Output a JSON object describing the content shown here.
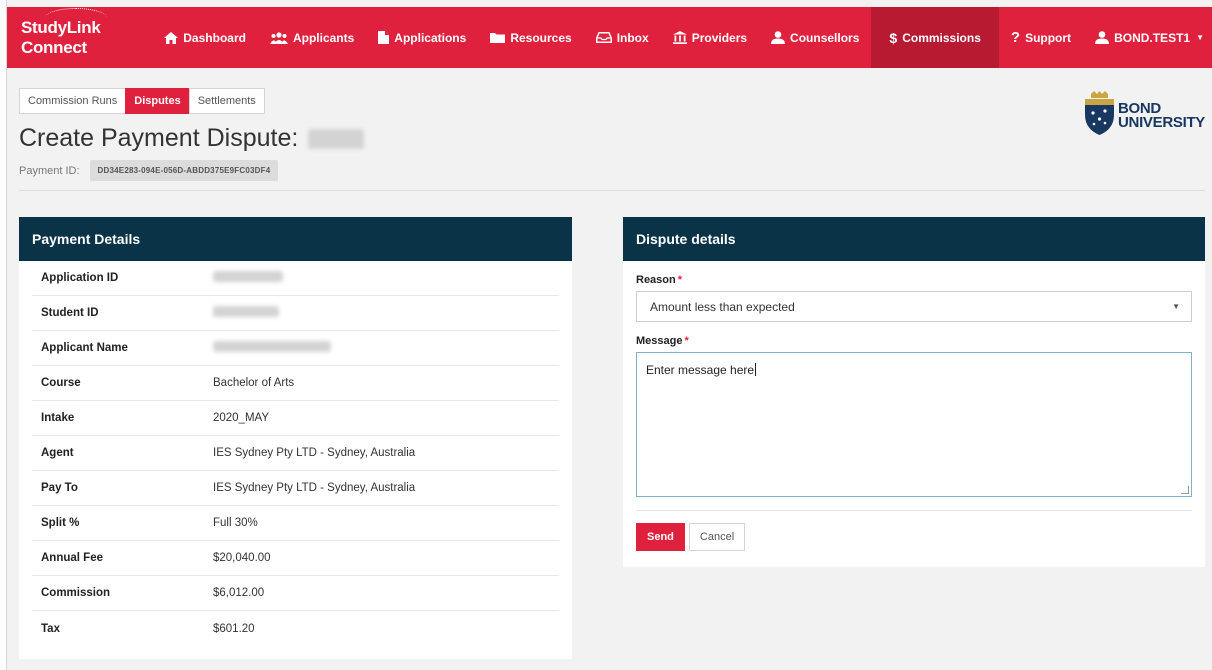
{
  "brand": {
    "name": "StudyLink Connect"
  },
  "nav": {
    "items": [
      {
        "key": "dashboard",
        "label": "Dashboard",
        "icon": "home-icon"
      },
      {
        "key": "applicants",
        "label": "Applicants",
        "icon": "users-icon"
      },
      {
        "key": "applications",
        "label": "Applications",
        "icon": "file-icon"
      },
      {
        "key": "resources",
        "label": "Resources",
        "icon": "folder-icon"
      },
      {
        "key": "inbox",
        "label": "Inbox",
        "icon": "inbox-icon"
      },
      {
        "key": "providers",
        "label": "Providers",
        "icon": "institution-icon"
      },
      {
        "key": "counsellors",
        "label": "Counsellors",
        "icon": "user-icon"
      },
      {
        "key": "commissions",
        "label": "Commissions",
        "icon": "dollar-icon",
        "active": true
      },
      {
        "key": "support",
        "label": "Support",
        "icon": "question-icon"
      }
    ],
    "user": "BOND.TEST1"
  },
  "subtabs": [
    {
      "label": "Commission Runs",
      "active": false
    },
    {
      "label": "Disputes",
      "active": true
    },
    {
      "label": "Settlements",
      "active": false
    }
  ],
  "page": {
    "title": "Create Payment Dispute:",
    "payment_id_label": "Payment ID:",
    "payment_id": "DD34E283-094E-056D-ABDD375E9FC03DF4"
  },
  "logo": {
    "line1": "BOND",
    "line2": "UNIVERSITY"
  },
  "payment_details": {
    "heading": "Payment Details",
    "rows": [
      {
        "label": "Application ID",
        "value": ""
      },
      {
        "label": "Student ID",
        "value": ""
      },
      {
        "label": "Applicant Name",
        "value": ""
      },
      {
        "label": "Course",
        "value": "Bachelor of Arts"
      },
      {
        "label": "Intake",
        "value": "2020_MAY"
      },
      {
        "label": "Agent",
        "value": "IES Sydney Pty LTD - Sydney, Australia"
      },
      {
        "label": "Pay To",
        "value": "IES Sydney Pty LTD - Sydney, Australia"
      },
      {
        "label": "Split %",
        "value": "Full 30%"
      },
      {
        "label": "Annual Fee",
        "value": "$20,040.00"
      },
      {
        "label": "Commission",
        "value": "$6,012.00"
      },
      {
        "label": "Tax",
        "value": "$601.20"
      }
    ]
  },
  "dispute": {
    "heading": "Dispute details",
    "reason_label": "Reason",
    "reason_value": "Amount less than expected",
    "message_label": "Message",
    "message_value": "Enter message here",
    "required_mark": "*",
    "send_label": "Send",
    "cancel_label": "Cancel"
  },
  "colors": {
    "brand": "#e0213d",
    "brand_active": "#b71a31",
    "panel_header": "#0b3347",
    "logo": "#183761"
  }
}
